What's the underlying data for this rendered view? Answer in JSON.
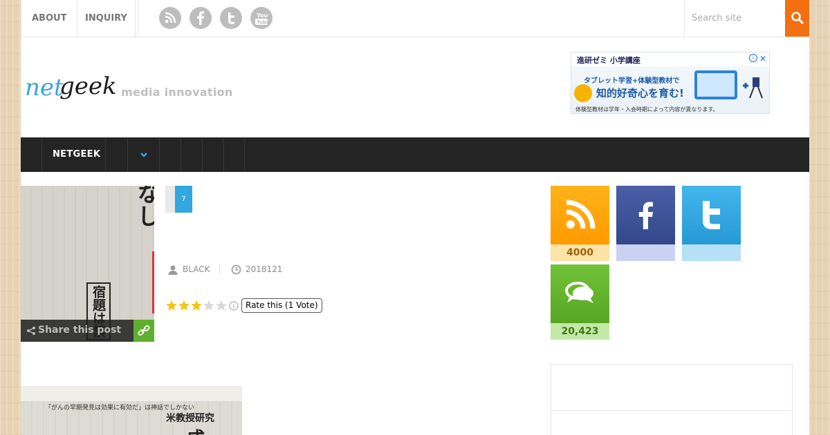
{
  "topnav": {
    "links": [
      "ABOUT",
      "INQUIRY"
    ],
    "social_icons": [
      "rss-icon",
      "facebook-icon",
      "twitter-icon",
      "youtube-icon"
    ],
    "search_placeholder": "Search site"
  },
  "header": {
    "logo_text_a": "net",
    "logo_text_b": "geek",
    "tagline": "media innovation"
  },
  "ad": {
    "title": "進研ゼミ 小学講座",
    "line1": "タブレット学習+体験型教材で",
    "line2": "知的好奇心を育む!",
    "footnote": "体験型教材は学年・入会時期によって内容が異なります。",
    "info_label": "i",
    "close_label": "✕"
  },
  "mainnav": {
    "label": "NETGEEK"
  },
  "post": {
    "count": "7",
    "author": "BLACK",
    "date": "2018121",
    "share_label": "Share this post",
    "rating": 3,
    "rating_max": 5,
    "rate_label": "Rate this (1 Vote)"
  },
  "newspaper": {
    "columns_1": [
      "成績向上に効果なし",
      "宿題は禁"
    ],
    "columns_2": [
      "米教授研究",
      "成"
    ],
    "caption_2": "「がんの早期発見は効果に有効だ」は神話でしかない"
  },
  "widgets": [
    {
      "name": "rss",
      "count": "4000",
      "color": "#ffa20a",
      "count_bg": "#fde3a6",
      "count_color": "#a0620a"
    },
    {
      "name": "facebook",
      "count": "",
      "color": "#3b4f93",
      "count_bg": "#c9d2f3",
      "count_color": "#3b4f93"
    },
    {
      "name": "twitter",
      "count": "",
      "color": "#2fa9e6",
      "count_bg": "#b6e0f6",
      "count_color": "#1f7fb0"
    },
    {
      "name": "comments",
      "count": "20,423",
      "color": "#62b32b",
      "count_bg": "#c3e8a7",
      "count_color": "#3d7b14"
    }
  ]
}
